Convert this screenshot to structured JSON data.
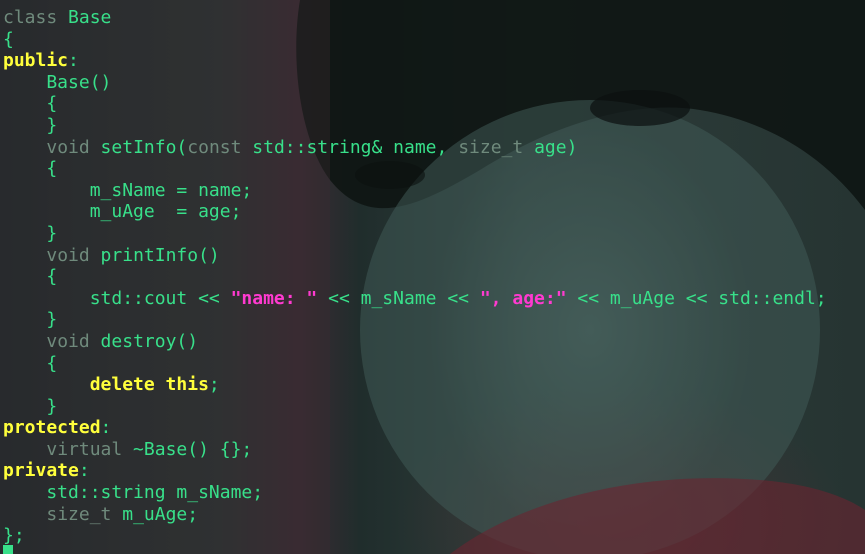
{
  "editor": {
    "colors": {
      "background": "#1a2826",
      "identifier": "#38e08a",
      "keyword_dim": "#6f8a7c",
      "keyword_bold": "#ffff3c",
      "string": "#ff3ad0"
    },
    "lines": [
      [
        {
          "t": "class ",
          "c": "tok-kw-dim"
        },
        {
          "t": "Base",
          "c": "tok-ident"
        }
      ],
      [
        {
          "t": "{",
          "c": "tok-brace"
        }
      ],
      [
        {
          "t": "public",
          "c": "tok-kw-bold"
        },
        {
          "t": ":",
          "c": "tok-brace"
        }
      ],
      [
        {
          "t": "    Base()",
          "c": "tok-ident"
        }
      ],
      [
        {
          "t": "    {",
          "c": "tok-brace"
        }
      ],
      [
        {
          "t": "    }",
          "c": "tok-brace"
        }
      ],
      [
        {
          "t": "    ",
          "c": "tok-ident"
        },
        {
          "t": "void",
          "c": "tok-kw-dim"
        },
        {
          "t": " setInfo(",
          "c": "tok-ident"
        },
        {
          "t": "const",
          "c": "tok-kw-dim"
        },
        {
          "t": " std::string& name, ",
          "c": "tok-ident"
        },
        {
          "t": "size_t",
          "c": "tok-kw-dim"
        },
        {
          "t": " age)",
          "c": "tok-ident"
        }
      ],
      [
        {
          "t": "    {",
          "c": "tok-brace"
        }
      ],
      [
        {
          "t": "        m_sName = name;",
          "c": "tok-ident"
        }
      ],
      [
        {
          "t": "        m_uAge  = age;",
          "c": "tok-ident"
        }
      ],
      [
        {
          "t": "    }",
          "c": "tok-brace"
        }
      ],
      [
        {
          "t": "    ",
          "c": "tok-ident"
        },
        {
          "t": "void",
          "c": "tok-kw-dim"
        },
        {
          "t": " printInfo()",
          "c": "tok-ident"
        }
      ],
      [
        {
          "t": "    {",
          "c": "tok-brace"
        }
      ],
      [
        {
          "t": "        std::cout << ",
          "c": "tok-ident"
        },
        {
          "t": "\"name: \"",
          "c": "tok-str"
        },
        {
          "t": " << m_sName << ",
          "c": "tok-ident"
        },
        {
          "t": "\", age:\"",
          "c": "tok-str"
        },
        {
          "t": " << m_uAge << std::endl;",
          "c": "tok-ident"
        }
      ],
      [
        {
          "t": "    }",
          "c": "tok-brace"
        }
      ],
      [
        {
          "t": "    ",
          "c": "tok-ident"
        },
        {
          "t": "void",
          "c": "tok-kw-dim"
        },
        {
          "t": " destroy()",
          "c": "tok-ident"
        }
      ],
      [
        {
          "t": "    {",
          "c": "tok-brace"
        }
      ],
      [
        {
          "t": "        ",
          "c": "tok-ident"
        },
        {
          "t": "delete this",
          "c": "tok-kw-bold"
        },
        {
          "t": ";",
          "c": "tok-ident"
        }
      ],
      [
        {
          "t": "    }",
          "c": "tok-brace"
        }
      ],
      [
        {
          "t": "protected",
          "c": "tok-kw-bold"
        },
        {
          "t": ":",
          "c": "tok-brace"
        }
      ],
      [
        {
          "t": "    ",
          "c": "tok-ident"
        },
        {
          "t": "virtual",
          "c": "tok-kw-dim"
        },
        {
          "t": " ~Base() {};",
          "c": "tok-ident"
        }
      ],
      [
        {
          "t": "private",
          "c": "tok-kw-bold"
        },
        {
          "t": ":",
          "c": "tok-brace"
        }
      ],
      [
        {
          "t": "    std::string m_sName;",
          "c": "tok-ident"
        }
      ],
      [
        {
          "t": "    ",
          "c": "tok-ident"
        },
        {
          "t": "size_t",
          "c": "tok-kw-dim"
        },
        {
          "t": " m_uAge;",
          "c": "tok-ident"
        }
      ],
      [
        {
          "t": "};",
          "c": "tok-brace"
        }
      ]
    ]
  }
}
